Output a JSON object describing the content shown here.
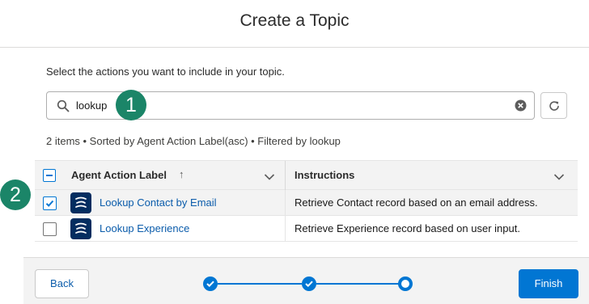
{
  "modal": {
    "title": "Create a Topic"
  },
  "instruction": "Select the actions you want to include in your topic.",
  "search": {
    "value": "lookup"
  },
  "callouts": {
    "one": "1",
    "two": "2"
  },
  "meta": "2 items • Sorted by Agent Action Label(asc) • Filtered by lookup",
  "table": {
    "columns": {
      "label": "Agent Action Label",
      "sort_arrow": "↑",
      "instructions": "Instructions"
    },
    "rows": [
      {
        "name": "Lookup Contact by Email",
        "instructions": "Retrieve Contact record based on an email address.",
        "checked": true
      },
      {
        "name": "Lookup Experience",
        "instructions": "Retrieve Experience record based on user input.",
        "checked": false
      }
    ]
  },
  "footer": {
    "back_label": "Back",
    "finish_label": "Finish",
    "progress": {
      "total_steps": 3,
      "completed_steps": 2,
      "current_step": 3
    }
  },
  "colors": {
    "brand": "#0176d3",
    "callout": "#1b8568",
    "link": "#0b5cab",
    "icon_bg": "#032d60"
  },
  "icons": [
    "search-icon",
    "clear-icon",
    "refresh-icon",
    "chevron-down-icon",
    "checkmark-icon",
    "agent-action-icon"
  ]
}
